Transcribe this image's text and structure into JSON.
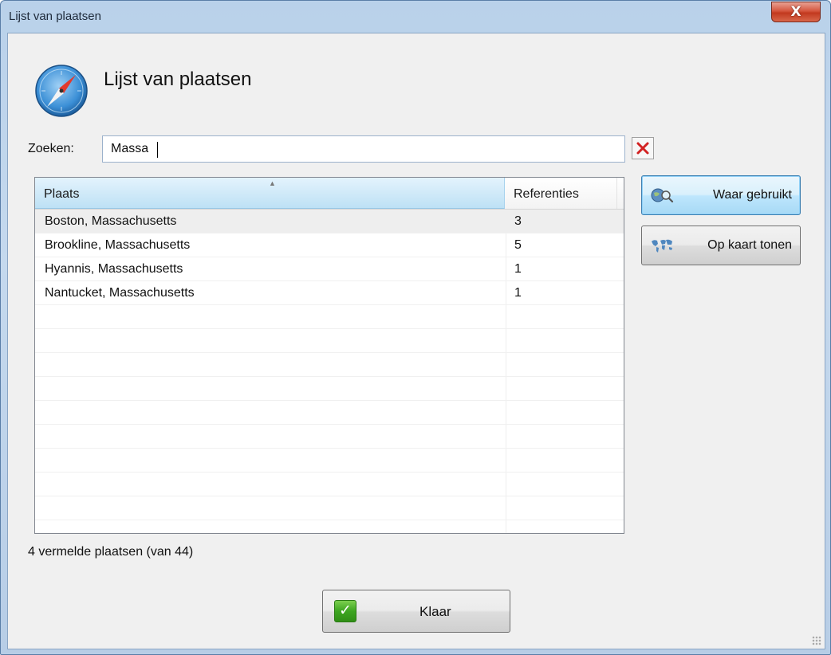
{
  "window": {
    "title": "Lijst van plaatsen",
    "close_glyph": "X"
  },
  "header": {
    "heading": "Lijst van plaatsen",
    "icon": "compass-icon"
  },
  "search": {
    "label": "Zoeken:",
    "value": "Massa",
    "clear_icon": "clear-x-icon"
  },
  "table": {
    "columns": [
      "Plaats",
      "Referenties"
    ],
    "sorted_column": "Plaats",
    "rows": [
      {
        "place": "Boston, Massachusetts",
        "refs": "3"
      },
      {
        "place": "Brookline, Massachusetts",
        "refs": "5"
      },
      {
        "place": "Hyannis, Massachusetts",
        "refs": "1"
      },
      {
        "place": "Nantucket, Massachusetts",
        "refs": "1"
      }
    ]
  },
  "actions": {
    "where_used_label": "Waar gebruikt",
    "where_used_icon": "globe-search-icon",
    "show_on_map_label": "Op kaart tonen",
    "show_on_map_icon": "world-map-icon"
  },
  "status": {
    "text": "4 vermelde plaatsen (van 44)"
  },
  "footer": {
    "ok_label": "Klaar",
    "ok_icon": "check-icon"
  },
  "colors": {
    "header_selected": "#cfe9f8",
    "accent_red": "#d22222",
    "ok_green": "#3da520"
  }
}
